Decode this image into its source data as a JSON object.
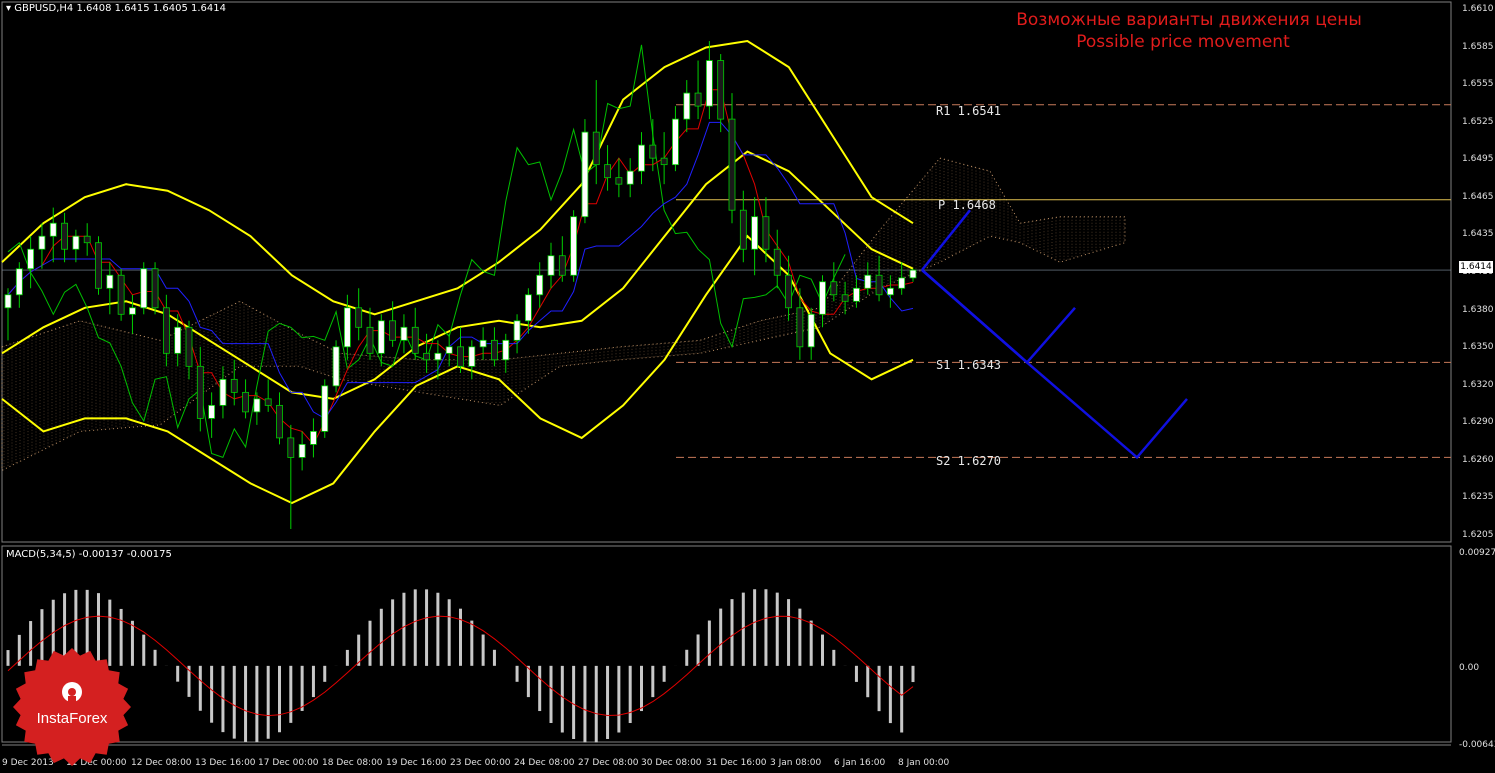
{
  "header": {
    "symbol_label": "GBPUSD,H4",
    "ohlc_values": "1.6408 1.6415 1.6405 1.6414",
    "macd_label": "MACD(5,34,5) -0.00137 -0.00175"
  },
  "titles": {
    "ru": "Возможные варианты движения цены",
    "en": "Possible price movement"
  },
  "levels": {
    "r1": "R1 1.6541",
    "p": "P 1.6468",
    "s1": "S1 1.6343",
    "s2": "S2 1.6270"
  },
  "current_price": "1.6414",
  "price_axis": [
    "1.6610",
    "1.6585",
    "1.6555",
    "1.6525",
    "1.6495",
    "1.6465",
    "1.6435",
    "1.6410",
    "1.6380",
    "1.6350",
    "1.6320",
    "1.6290",
    "1.6260",
    "1.6235",
    "1.6205"
  ],
  "macd_axis": [
    "0.00927",
    "0.00",
    "-0.00643"
  ],
  "time_axis": [
    "9 Dec 2013",
    "11 Dec 00:00",
    "12 Dec 08:00",
    "13 Dec 16:00",
    "17 Dec 00:00",
    "18 Dec 08:00",
    "19 Dec 16:00",
    "23 Dec 00:00",
    "24 Dec 08:00",
    "27 Dec 08:00",
    "30 Dec 08:00",
    "31 Dec 16:00",
    "3 Jan 08:00",
    "6 Jan 16:00",
    "8 Jan 00:00"
  ],
  "logo": {
    "text": "InstaForex"
  },
  "colors": {
    "background": "#000000",
    "up_candle": "#ffffff",
    "down_candle": "#1a1a1a",
    "bollinger": "#ffff00",
    "green_line": "#00c000",
    "red_line": "#e00000",
    "blue_line": "#2020ff",
    "forecast": "#1010e0",
    "cloud": "#d2a070",
    "levels": "#c87a5a",
    "pivot": "#e0c050",
    "macd_hist": "#c8c8c8",
    "macd_signal": "#e00000",
    "title": "#e21c1c",
    "logo": "#d42020"
  },
  "chart_data": {
    "type": "candlestick",
    "symbol": "GBPUSD",
    "timeframe": "H4",
    "ylim": [
      1.6205,
      1.662
    ],
    "candles": [
      [
        1.6385,
        1.64,
        1.636,
        1.6395
      ],
      [
        1.6395,
        1.642,
        1.6385,
        1.6415
      ],
      [
        1.6415,
        1.644,
        1.64,
        1.643
      ],
      [
        1.643,
        1.645,
        1.6415,
        1.644
      ],
      [
        1.644,
        1.6462,
        1.642,
        1.645
      ],
      [
        1.645,
        1.6458,
        1.642,
        1.643
      ],
      [
        1.643,
        1.6445,
        1.642,
        1.644
      ],
      [
        1.644,
        1.645,
        1.6425,
        1.6435
      ],
      [
        1.6435,
        1.644,
        1.6395,
        1.64
      ],
      [
        1.64,
        1.642,
        1.638,
        1.641
      ],
      [
        1.641,
        1.6415,
        1.6375,
        1.638
      ],
      [
        1.638,
        1.6395,
        1.6365,
        1.6385
      ],
      [
        1.6385,
        1.642,
        1.638,
        1.6415
      ],
      [
        1.6415,
        1.642,
        1.638,
        1.6385
      ],
      [
        1.6385,
        1.6395,
        1.634,
        1.635
      ],
      [
        1.635,
        1.638,
        1.634,
        1.637
      ],
      [
        1.637,
        1.6375,
        1.633,
        1.634
      ],
      [
        1.634,
        1.6355,
        1.629,
        1.63
      ],
      [
        1.63,
        1.632,
        1.6285,
        1.631
      ],
      [
        1.631,
        1.634,
        1.63,
        1.633
      ],
      [
        1.633,
        1.6345,
        1.631,
        1.632
      ],
      [
        1.632,
        1.633,
        1.63,
        1.6305
      ],
      [
        1.6305,
        1.632,
        1.6295,
        1.6315
      ],
      [
        1.6315,
        1.633,
        1.6305,
        1.631
      ],
      [
        1.631,
        1.632,
        1.628,
        1.6285
      ],
      [
        1.6285,
        1.6295,
        1.6215,
        1.627
      ],
      [
        1.627,
        1.629,
        1.626,
        1.628
      ],
      [
        1.628,
        1.63,
        1.627,
        1.629
      ],
      [
        1.629,
        1.633,
        1.6285,
        1.6325
      ],
      [
        1.6325,
        1.636,
        1.632,
        1.6355
      ],
      [
        1.6355,
        1.6395,
        1.6345,
        1.6385
      ],
      [
        1.6385,
        1.64,
        1.636,
        1.637
      ],
      [
        1.637,
        1.6385,
        1.6345,
        1.635
      ],
      [
        1.635,
        1.638,
        1.634,
        1.6375
      ],
      [
        1.6375,
        1.639,
        1.6355,
        1.636
      ],
      [
        1.636,
        1.638,
        1.635,
        1.637
      ],
      [
        1.637,
        1.6385,
        1.6345,
        1.635
      ],
      [
        1.635,
        1.6365,
        1.6335,
        1.6345
      ],
      [
        1.6345,
        1.636,
        1.633,
        1.635
      ],
      [
        1.635,
        1.6365,
        1.634,
        1.6355
      ],
      [
        1.6355,
        1.637,
        1.6335,
        1.634
      ],
      [
        1.634,
        1.636,
        1.633,
        1.6355
      ],
      [
        1.6355,
        1.637,
        1.6345,
        1.636
      ],
      [
        1.636,
        1.637,
        1.634,
        1.6345
      ],
      [
        1.6345,
        1.6365,
        1.6335,
        1.636
      ],
      [
        1.636,
        1.638,
        1.635,
        1.6375
      ],
      [
        1.6375,
        1.64,
        1.6365,
        1.6395
      ],
      [
        1.6395,
        1.642,
        1.6385,
        1.641
      ],
      [
        1.641,
        1.6435,
        1.64,
        1.6425
      ],
      [
        1.6425,
        1.644,
        1.6405,
        1.641
      ],
      [
        1.641,
        1.646,
        1.6405,
        1.6455
      ],
      [
        1.6455,
        1.653,
        1.645,
        1.652
      ],
      [
        1.652,
        1.656,
        1.648,
        1.6495
      ],
      [
        1.6495,
        1.651,
        1.6475,
        1.6485
      ],
      [
        1.6485,
        1.65,
        1.647,
        1.648
      ],
      [
        1.648,
        1.65,
        1.647,
        1.649
      ],
      [
        1.649,
        1.652,
        1.648,
        1.651
      ],
      [
        1.651,
        1.653,
        1.649,
        1.65
      ],
      [
        1.65,
        1.652,
        1.648,
        1.6495
      ],
      [
        1.6495,
        1.654,
        1.649,
        1.653
      ],
      [
        1.653,
        1.656,
        1.652,
        1.655
      ],
      [
        1.655,
        1.6575,
        1.653,
        1.654
      ],
      [
        1.654,
        1.659,
        1.653,
        1.6575
      ],
      [
        1.6575,
        1.658,
        1.652,
        1.653
      ],
      [
        1.653,
        1.655,
        1.645,
        1.646
      ],
      [
        1.646,
        1.6475,
        1.642,
        1.643
      ],
      [
        1.643,
        1.647,
        1.641,
        1.6455
      ],
      [
        1.6455,
        1.647,
        1.642,
        1.643
      ],
      [
        1.643,
        1.6445,
        1.64,
        1.641
      ],
      [
        1.641,
        1.6425,
        1.6375,
        1.6385
      ],
      [
        1.6385,
        1.64,
        1.6345,
        1.6355
      ],
      [
        1.6355,
        1.6385,
        1.6345,
        1.638
      ],
      [
        1.638,
        1.641,
        1.637,
        1.6405
      ],
      [
        1.6405,
        1.642,
        1.639,
        1.6395
      ],
      [
        1.6395,
        1.6405,
        1.638,
        1.639
      ],
      [
        1.639,
        1.641,
        1.6385,
        1.64
      ],
      [
        1.64,
        1.642,
        1.6395,
        1.641
      ],
      [
        1.641,
        1.6425,
        1.639,
        1.6395
      ],
      [
        1.6395,
        1.641,
        1.6385,
        1.64
      ],
      [
        1.64,
        1.642,
        1.6395,
        1.6408
      ],
      [
        1.6408,
        1.6415,
        1.6405,
        1.6414
      ]
    ],
    "bollinger_upper": [
      1.642,
      1.645,
      1.647,
      1.648,
      1.6475,
      1.646,
      1.644,
      1.641,
      1.639,
      1.638,
      1.639,
      1.64,
      1.642,
      1.6445,
      1.648,
      1.6545,
      1.657,
      1.6585,
      1.659,
      1.657,
      1.652,
      1.647,
      1.645
    ],
    "bollinger_mid": [
      1.635,
      1.637,
      1.6385,
      1.639,
      1.638,
      1.636,
      1.634,
      1.632,
      1.6315,
      1.633,
      1.6355,
      1.637,
      1.6375,
      1.637,
      1.6375,
      1.64,
      1.644,
      1.648,
      1.6505,
      1.649,
      1.646,
      1.643,
      1.6415
    ],
    "bollinger_lower": [
      1.6315,
      1.629,
      1.63,
      1.63,
      1.629,
      1.627,
      1.625,
      1.6235,
      1.625,
      1.629,
      1.6325,
      1.634,
      1.633,
      1.63,
      1.6285,
      1.631,
      1.6345,
      1.6395,
      1.644,
      1.641,
      1.635,
      1.633,
      1.6345
    ],
    "ichimoku_cloud": "between 1.6300 and 1.6510",
    "pivot_levels": {
      "R1": 1.6541,
      "P": 1.6468,
      "S1": 1.6343,
      "S2": 1.627
    },
    "forecast_paths": [
      [
        [
          1.6414
        ],
        [
          1.646
        ]
      ],
      [
        [
          1.6414
        ],
        [
          1.6343
        ],
        [
          1.6385
        ]
      ],
      [
        [
          1.6414
        ],
        [
          1.6343
        ],
        [
          1.627
        ],
        [
          1.6315
        ]
      ]
    ],
    "macd": {
      "params": "5,34,5",
      "value": -0.00137,
      "signal": -0.00175,
      "ylim": [
        -0.00643,
        0.00927
      ]
    }
  }
}
